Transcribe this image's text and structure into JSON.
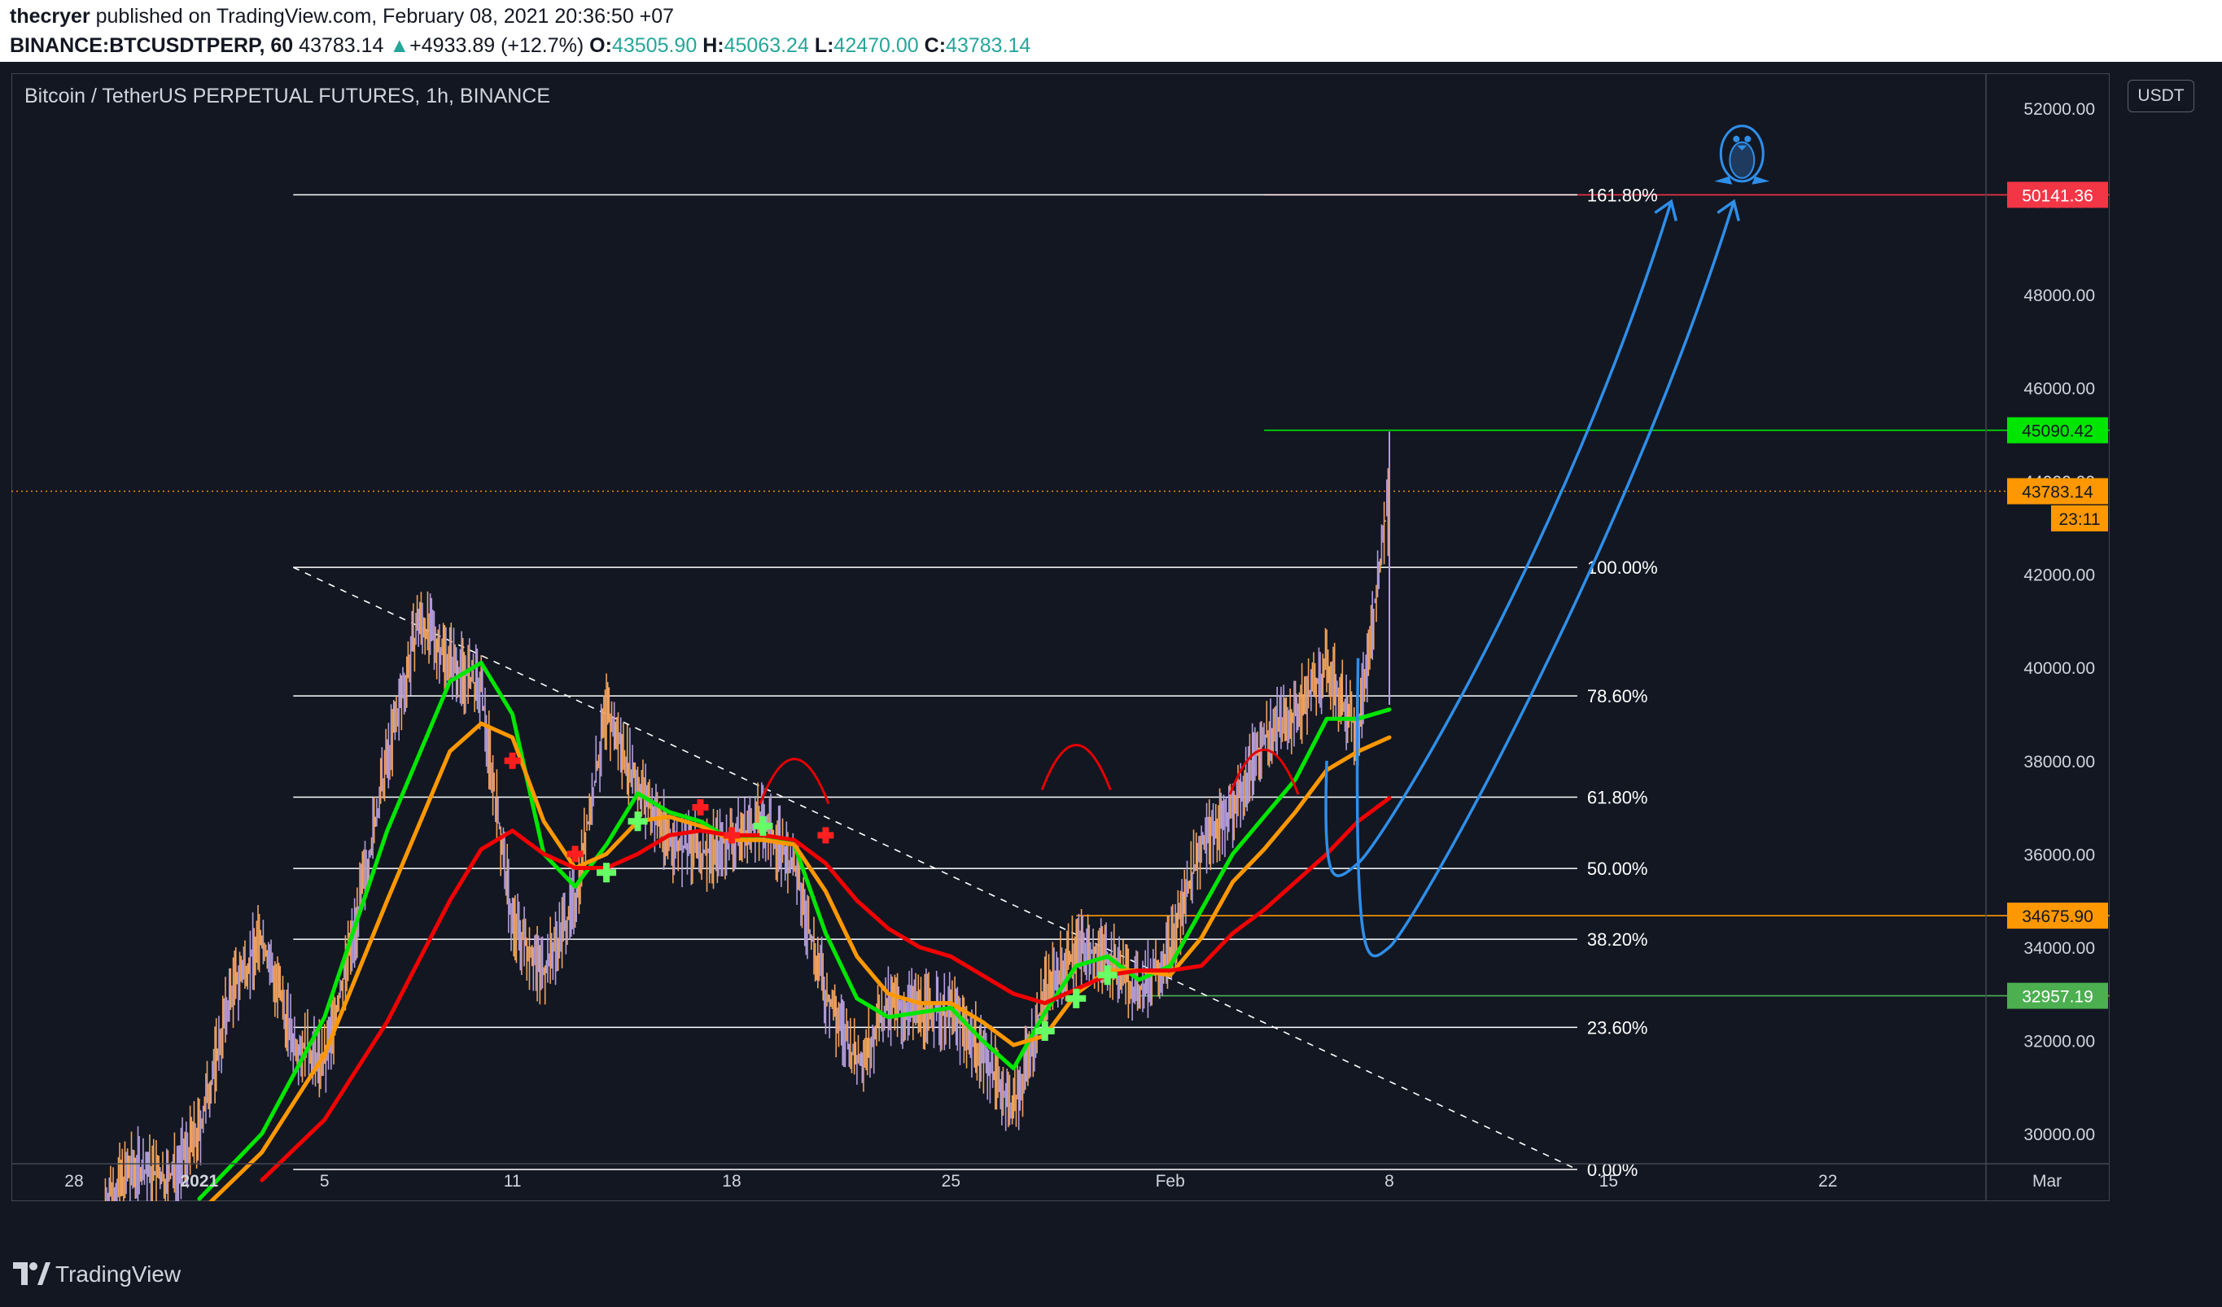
{
  "header": {
    "publisher": "thecryer",
    "published_text": "published on TradingView.com, February 08, 2021 20:36:50 +07",
    "symbol": "BINANCE:BTCUSDTPERP, 60",
    "last": "43783.14",
    "change": "+4933.89 (+12.7%)",
    "o_label": "O:",
    "o_value": "43505.90",
    "h_label": "H:",
    "h_value": "45063.24",
    "l_label": "L:",
    "l_value": "42470.00",
    "c_label": "C:",
    "c_value": "43783.14",
    "up_arrow": "▲"
  },
  "chart_legend": "Bitcoin / TetherUS PERPETUAL FUTURES, 1h, BINANCE",
  "currency_button": "USDT",
  "footer": {
    "brand": "TradingView",
    "logo_icon": "tradingview-logo-icon"
  },
  "annotation_icon": "penguin-icon",
  "chart_data": {
    "type": "line",
    "title": "Bitcoin / TetherUS PERPETUAL FUTURES, 1h, BINANCE",
    "x_tick_labels": [
      "28",
      "2021",
      "5",
      "11",
      "18",
      "25",
      "Feb",
      "8",
      "15",
      "22",
      "Mar"
    ],
    "y_tick_labels": [
      "30000.00",
      "32000.00",
      "34000.00",
      "36000.00",
      "38000.00",
      "40000.00",
      "42000.00",
      "44000.00",
      "46000.00",
      "48000.00",
      "50000.00",
      "52000.00"
    ],
    "y_ticks": [
      30000,
      32000,
      34000,
      36000,
      38000,
      40000,
      42000,
      44000,
      46000,
      48000,
      50000,
      52000
    ],
    "ylim": [
      28550,
      52750
    ],
    "x_range_days": [
      "2020-12-26",
      "2021-03-03"
    ],
    "price_tags": [
      {
        "label": "50141.36",
        "value": 50141.36,
        "color": "#f23645"
      },
      {
        "label": "45090.42",
        "value": 45090.42,
        "color": "#00e600"
      },
      {
        "label": "43783.14",
        "value": 43783.14,
        "color": "#ff9800"
      },
      {
        "label": "23:11",
        "value": 43200,
        "color": "#ff9800"
      },
      {
        "label": "34675.90",
        "value": 34675.9,
        "color": "#ff9800"
      },
      {
        "label": "32957.19",
        "value": 32957.19,
        "color": "#4caf50"
      }
    ],
    "horizontal_levels": [
      {
        "value": 50141.36,
        "from": "2021-02-04",
        "color": "#f23645"
      },
      {
        "value": 45090.42,
        "from": "2021-02-04",
        "color": "#00e600"
      },
      {
        "value": 34675.9,
        "from": "2021-01-29",
        "color": "#ff9800"
      },
      {
        "value": 32957.19,
        "from": "2021-01-31",
        "color": "#4caf50"
      }
    ],
    "current_price": 43783.14,
    "fibonacci": {
      "from": "2021-01-04",
      "to": "2021-02-14",
      "levels": [
        {
          "label": "161.80%",
          "value": 50141.36
        },
        {
          "label": "100.00%",
          "value": 42150
        },
        {
          "label": "78.60%",
          "value": 39390
        },
        {
          "label": "61.80%",
          "value": 37220
        },
        {
          "label": "50.00%",
          "value": 35690
        },
        {
          "label": "38.20%",
          "value": 34170
        },
        {
          "label": "23.60%",
          "value": 32280
        },
        {
          "label": "0.00%",
          "value": 29230
        }
      ]
    },
    "trendline": {
      "start": [
        "2021-01-04",
        42150
      ],
      "end": [
        "2021-02-14",
        29230
      ],
      "style": "dashed"
    },
    "price_series": {
      "name": "BTCUSDTPERP",
      "x": [
        "2020-12-29",
        "2020-12-30",
        "2020-12-31",
        "2021-01-01",
        "2021-01-02",
        "2021-01-03",
        "2021-01-04",
        "2021-01-05",
        "2021-01-06",
        "2021-01-07",
        "2021-01-08",
        "2021-01-09",
        "2021-01-10",
        "2021-01-11",
        "2021-01-12",
        "2021-01-13",
        "2021-01-14",
        "2021-01-15",
        "2021-01-16",
        "2021-01-17",
        "2021-01-18",
        "2021-01-19",
        "2021-01-20",
        "2021-01-21",
        "2021-01-22",
        "2021-01-23",
        "2021-01-24",
        "2021-01-25",
        "2021-01-26",
        "2021-01-27",
        "2021-01-28",
        "2021-01-29",
        "2021-01-30",
        "2021-01-31",
        "2021-02-01",
        "2021-02-02",
        "2021-02-03",
        "2021-02-04",
        "2021-02-05",
        "2021-02-06",
        "2021-02-07",
        "2021-02-08"
      ],
      "y": [
        28600,
        29300,
        29000,
        30000,
        33000,
        34200,
        32000,
        31500,
        34500,
        38000,
        41000,
        40200,
        39500,
        34500,
        33500,
        35000,
        39000,
        37500,
        36300,
        36000,
        36300,
        36700,
        35700,
        33000,
        31500,
        32700,
        32700,
        32600,
        31800,
        30500,
        33000,
        34000,
        33800,
        33000,
        34000,
        36200,
        37000,
        38500,
        39000,
        40000,
        38600,
        43783
      ]
    },
    "series": [
      {
        "name": "green",
        "color": "#00e600",
        "x": [
          "2021-01-01",
          "2021-01-03",
          "2021-01-05",
          "2021-01-07",
          "2021-01-09",
          "2021-01-10",
          "2021-01-11",
          "2021-01-12",
          "2021-01-13",
          "2021-01-14",
          "2021-01-15",
          "2021-01-16",
          "2021-01-17",
          "2021-01-18",
          "2021-01-19",
          "2021-01-20",
          "2021-01-21",
          "2021-01-22",
          "2021-01-23",
          "2021-01-24",
          "2021-01-25",
          "2021-01-26",
          "2021-01-27",
          "2021-01-28",
          "2021-01-29",
          "2021-01-30",
          "2021-01-31",
          "2021-02-01",
          "2021-02-02",
          "2021-02-03",
          "2021-02-04",
          "2021-02-05",
          "2021-02-06",
          "2021-02-07",
          "2021-02-08"
        ],
        "y": [
          28600,
          30000,
          32500,
          36500,
          39700,
          40100,
          39000,
          36000,
          35300,
          36200,
          37300,
          36900,
          36700,
          36300,
          36400,
          36200,
          34300,
          32900,
          32500,
          32600,
          32700,
          32000,
          31400,
          32600,
          33600,
          33800,
          33300,
          33600,
          34800,
          36000,
          36800,
          37600,
          38900,
          38900,
          39100
        ]
      },
      {
        "name": "orange",
        "color": "#ff9800",
        "x": [
          "2021-01-01",
          "2021-01-03",
          "2021-01-05",
          "2021-01-07",
          "2021-01-09",
          "2021-01-10",
          "2021-01-11",
          "2021-01-12",
          "2021-01-13",
          "2021-01-14",
          "2021-01-15",
          "2021-01-16",
          "2021-01-17",
          "2021-01-18",
          "2021-01-19",
          "2021-01-20",
          "2021-01-21",
          "2021-01-22",
          "2021-01-23",
          "2021-01-24",
          "2021-01-25",
          "2021-01-26",
          "2021-01-27",
          "2021-01-28",
          "2021-01-29",
          "2021-01-30",
          "2021-01-31",
          "2021-02-01",
          "2021-02-02",
          "2021-02-03",
          "2021-02-04",
          "2021-02-05",
          "2021-02-06",
          "2021-02-07",
          "2021-02-08"
        ],
        "y": [
          28300,
          29600,
          31700,
          35000,
          38200,
          38800,
          38500,
          36700,
          35700,
          36000,
          36700,
          36800,
          36600,
          36300,
          36300,
          36200,
          35200,
          33800,
          33000,
          32800,
          32800,
          32400,
          31900,
          32100,
          33000,
          33500,
          33500,
          33400,
          34200,
          35400,
          36100,
          36900,
          37800,
          38200,
          38500
        ]
      },
      {
        "name": "red",
        "color": "#f00000",
        "x": [
          "2021-01-03",
          "2021-01-05",
          "2021-01-07",
          "2021-01-09",
          "2021-01-10",
          "2021-01-11",
          "2021-01-12",
          "2021-01-13",
          "2021-01-14",
          "2021-01-15",
          "2021-01-16",
          "2021-01-17",
          "2021-01-18",
          "2021-01-19",
          "2021-01-20",
          "2021-01-21",
          "2021-01-22",
          "2021-01-23",
          "2021-01-24",
          "2021-01-25",
          "2021-01-26",
          "2021-01-27",
          "2021-01-28",
          "2021-01-29",
          "2021-01-30",
          "2021-01-31",
          "2021-02-01",
          "2021-02-02",
          "2021-02-03",
          "2021-02-04",
          "2021-02-05",
          "2021-02-06",
          "2021-02-07",
          "2021-02-08"
        ],
        "y": [
          29000,
          30300,
          32400,
          35000,
          36100,
          36500,
          36000,
          35700,
          35700,
          36000,
          36400,
          36500,
          36400,
          36400,
          36300,
          35800,
          35000,
          34400,
          34000,
          33800,
          33400,
          33000,
          32800,
          33100,
          33400,
          33500,
          33500,
          33600,
          34300,
          34800,
          35400,
          36000,
          36700,
          37200
        ]
      }
    ],
    "markers": [
      {
        "type": "sell",
        "x": "2021-01-11",
        "y": 38000
      },
      {
        "type": "sell",
        "x": "2021-01-13",
        "y": 36000
      },
      {
        "type": "buy",
        "x": "2021-01-14",
        "y": 35600
      },
      {
        "type": "buy",
        "x": "2021-01-15",
        "y": 36700
      },
      {
        "type": "sell",
        "x": "2021-01-17",
        "y": 37000
      },
      {
        "type": "sell",
        "x": "2021-01-18",
        "y": 36400
      },
      {
        "type": "buy",
        "x": "2021-01-19",
        "y": 36600
      },
      {
        "type": "sell",
        "x": "2021-01-21",
        "y": 36400
      },
      {
        "type": "buy",
        "x": "2021-01-28",
        "y": 32200
      },
      {
        "type": "buy",
        "x": "2021-01-29",
        "y": 32900
      },
      {
        "type": "buy",
        "x": "2021-01-30",
        "y": 33400
      }
    ],
    "annotations": {
      "red_arcs": [
        {
          "x": "2021-01-20",
          "y": 37600
        },
        {
          "x": "2021-01-29",
          "y": 37900
        },
        {
          "x": "2021-02-04",
          "y": 37800
        }
      ],
      "projection_arrows": [
        {
          "from": [
            "2021-02-06",
            38000
          ],
          "low": [
            "2021-02-07",
            35800
          ],
          "to": [
            "2021-02-17",
            50000
          ]
        },
        {
          "from": [
            "2021-02-07",
            40200
          ],
          "low": [
            "2021-02-08",
            34000
          ],
          "to": [
            "2021-02-19",
            50000
          ]
        }
      ]
    }
  }
}
